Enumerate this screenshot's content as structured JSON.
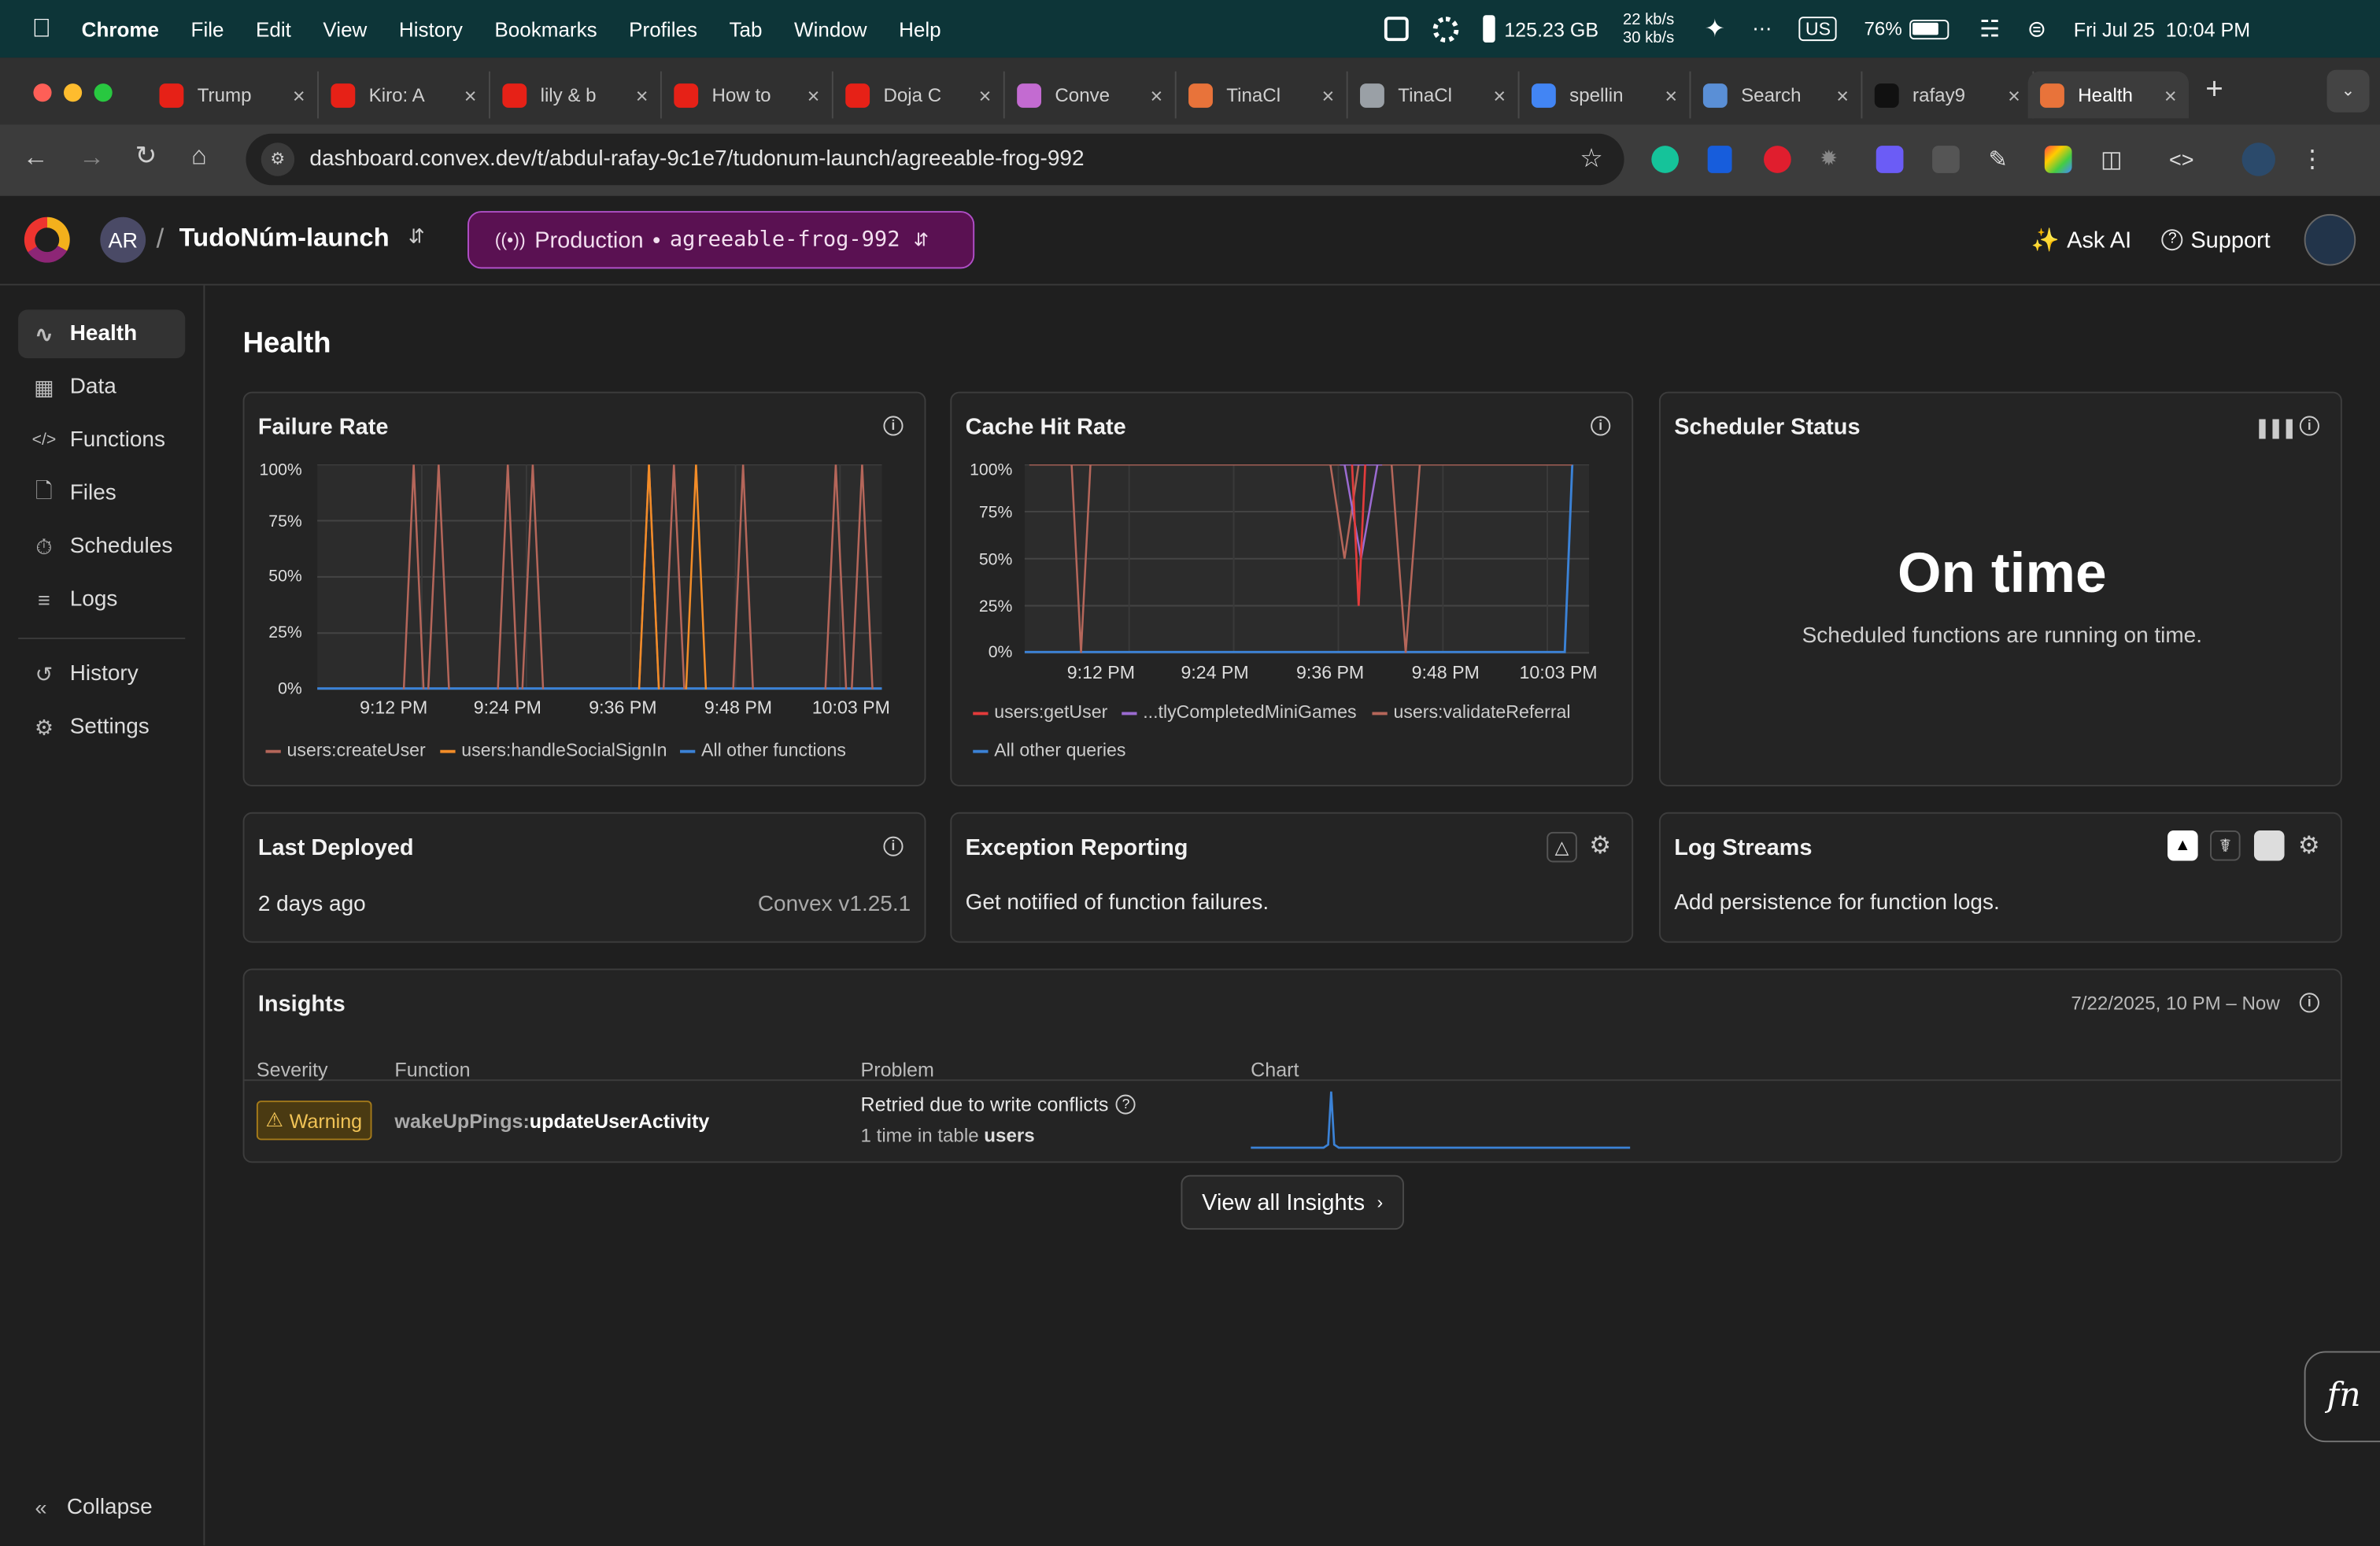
{
  "menubar": {
    "app": "Chrome",
    "items": [
      "File",
      "Edit",
      "View",
      "History",
      "Bookmarks",
      "Profiles",
      "Tab",
      "Window",
      "Help"
    ],
    "disk": "125.23 GB",
    "net_up": "22 kb/s",
    "net_down": "30 kb/s",
    "input": "US",
    "battery": "76%",
    "datetime": "Fri Jul 25  10:04 PM"
  },
  "tabs": [
    {
      "title": "Trump",
      "color": "#e62117"
    },
    {
      "title": "Kiro: A",
      "color": "#e62117"
    },
    {
      "title": "lily & b",
      "color": "#e62117"
    },
    {
      "title": "How to",
      "color": "#e62117"
    },
    {
      "title": "Doja C",
      "color": "#e62117"
    },
    {
      "title": "Conve",
      "color": "#c36bd1"
    },
    {
      "title": "TinaCl",
      "color": "#e8733a"
    },
    {
      "title": "TinaCl",
      "color": "#9aa0a6"
    },
    {
      "title": "spellin",
      "color": "#4285f4"
    },
    {
      "title": "Search",
      "color": "#5a8fd6"
    },
    {
      "title": "rafay9",
      "color": "#111111"
    },
    {
      "title": "Health",
      "color": "#e8733a"
    }
  ],
  "url": "dashboard.convex.dev/t/abdul-rafay-9c1e7/tudonum-launch/agreeable-frog-992",
  "header": {
    "avatar": "AR",
    "sep": "/",
    "project": "TudoNúm-launch",
    "env_label": "Production",
    "env_dot": "•",
    "env_name": "agreeable-frog-992",
    "ask_ai": "Ask AI",
    "support": "Support"
  },
  "sidebar": {
    "items": [
      {
        "label": "Health",
        "icon": "pulse-icon"
      },
      {
        "label": "Data",
        "icon": "table-icon"
      },
      {
        "label": "Functions",
        "icon": "code-icon"
      },
      {
        "label": "Files",
        "icon": "file-icon"
      },
      {
        "label": "Schedules",
        "icon": "stopwatch-icon"
      },
      {
        "label": "Logs",
        "icon": "list-icon"
      },
      {
        "label": "History",
        "icon": "history-icon"
      },
      {
        "label": "Settings",
        "icon": "gear-icon"
      }
    ],
    "collapse": "Collapse"
  },
  "page": {
    "title": "Health"
  },
  "failure": {
    "title": "Failure Rate",
    "legend": [
      "users:createUser",
      "users:handleSocialSignIn",
      "All other functions"
    ]
  },
  "cache": {
    "title": "Cache Hit Rate",
    "legend": [
      "users:getUser",
      "...tlyCompletedMiniGames",
      "users:validateReferral",
      "All other queries"
    ]
  },
  "scheduler": {
    "title": "Scheduler Status",
    "status": "On time",
    "desc": "Scheduled functions are running on time."
  },
  "deployed": {
    "title": "Last Deployed",
    "ago": "2 days ago",
    "version": "Convex v1.25.1"
  },
  "exception": {
    "title": "Exception Reporting",
    "desc": "Get notified of function failures."
  },
  "logstreams": {
    "title": "Log Streams",
    "desc": "Add persistence for function logs."
  },
  "insights": {
    "title": "Insights",
    "range": "7/22/2025, 10 PM – Now",
    "columns": [
      "Severity",
      "Function",
      "Problem",
      "Chart"
    ],
    "row": {
      "severity": "Warning",
      "fn_prefix": "wakeUpPings:",
      "fn_name": "updateUserActivity",
      "problem": "Retried due to write conflicts",
      "detail_pre": "1 time in table ",
      "detail_table": "users"
    },
    "view_all": "View all Insights"
  },
  "chart_data": [
    {
      "type": "line",
      "title": "Failure Rate",
      "ylim": [
        0,
        100
      ],
      "y_ticks": [
        "100%",
        "75%",
        "50%",
        "25%",
        "0%"
      ],
      "x_ticks": [
        "9:12 PM",
        "9:24 PM",
        "9:36 PM",
        "9:48 PM",
        "10:03 PM"
      ],
      "x_range": [
        0,
        60
      ],
      "series": [
        {
          "name": "users:createUser",
          "color": "#b5665a",
          "spikes": [
            [
              9.2,
              11.3
            ],
            [
              11.8,
              14.0
            ],
            [
              19.2,
              21.3
            ],
            [
              21.8,
              24.0
            ],
            [
              34.2,
              36.3
            ],
            [
              36.8,
              39.0
            ],
            [
              44.2,
              46.3
            ],
            [
              54.0,
              56.2
            ],
            [
              56.8,
              59.0
            ]
          ]
        },
        {
          "name": "users:handleSocialSignIn",
          "color": "#f28c28",
          "spikes": [
            [
              34.2,
              36.3
            ],
            [
              39.2,
              41.3
            ]
          ]
        },
        {
          "name": "All other functions",
          "color": "#3b82d6",
          "values": "0% throughout"
        }
      ]
    },
    {
      "type": "line",
      "title": "Cache Hit Rate",
      "ylim": [
        0,
        100
      ],
      "y_ticks": [
        "100%",
        "75%",
        "50%",
        "25%",
        "0%"
      ],
      "x_ticks": [
        "9:12 PM",
        "9:24 PM",
        "9:36 PM",
        "9:48 PM",
        "10:03 PM"
      ],
      "x_range": [
        0,
        60
      ],
      "series": [
        {
          "name": "users:getUser",
          "color": "#e33b3b",
          "dips": [
            [
              34.8,
              36.2,
              25
            ]
          ]
        },
        {
          "name": "...tlyCompletedMiniGames",
          "color": "#9b6bd1",
          "dips": [
            [
              34.0,
              37.5,
              50
            ]
          ]
        },
        {
          "name": "users:validateReferral",
          "color": "#b5665a",
          "dips": [
            [
              5.0,
              7.0,
              0
            ],
            [
              32.5,
              35.5,
              50
            ],
            [
              39.0,
              42.0,
              0
            ]
          ]
        },
        {
          "name": "All other queries",
          "color": "#3b82d6",
          "shape": "0% until 58, then 100%"
        }
      ]
    }
  ]
}
